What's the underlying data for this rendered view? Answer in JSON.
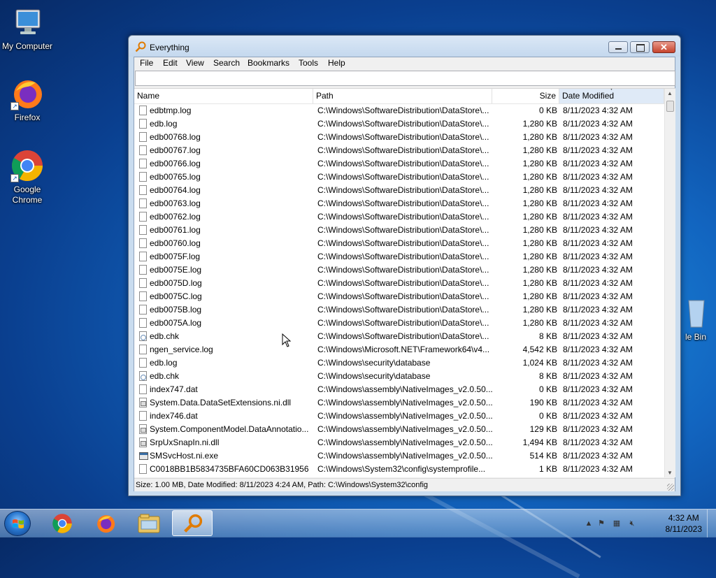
{
  "desktop": {
    "icons": [
      {
        "label": "My Computer"
      },
      {
        "label": "Firefox"
      },
      {
        "label": "Google Chrome"
      },
      {
        "label": "le Bin"
      }
    ]
  },
  "window": {
    "title": "Everything",
    "menu": [
      "File",
      "Edit",
      "View",
      "Search",
      "Bookmarks",
      "Tools",
      "Help"
    ],
    "search": {
      "value": "",
      "placeholder": ""
    },
    "columns": {
      "name": "Name",
      "path": "Path",
      "size": "Size",
      "date": "Date Modified"
    },
    "rows": [
      {
        "name": "edbtmp.log",
        "path": "C:\\Windows\\SoftwareDistribution\\DataStore\\...",
        "size": "0 KB",
        "date": "8/11/2023 4:32 AM",
        "icon": "file-icon"
      },
      {
        "name": "edb.log",
        "path": "C:\\Windows\\SoftwareDistribution\\DataStore\\...",
        "size": "1,280 KB",
        "date": "8/11/2023 4:32 AM",
        "icon": "file-icon"
      },
      {
        "name": "edb00768.log",
        "path": "C:\\Windows\\SoftwareDistribution\\DataStore\\...",
        "size": "1,280 KB",
        "date": "8/11/2023 4:32 AM",
        "icon": "file-icon"
      },
      {
        "name": "edb00767.log",
        "path": "C:\\Windows\\SoftwareDistribution\\DataStore\\...",
        "size": "1,280 KB",
        "date": "8/11/2023 4:32 AM",
        "icon": "file-icon"
      },
      {
        "name": "edb00766.log",
        "path": "C:\\Windows\\SoftwareDistribution\\DataStore\\...",
        "size": "1,280 KB",
        "date": "8/11/2023 4:32 AM",
        "icon": "file-icon"
      },
      {
        "name": "edb00765.log",
        "path": "C:\\Windows\\SoftwareDistribution\\DataStore\\...",
        "size": "1,280 KB",
        "date": "8/11/2023 4:32 AM",
        "icon": "file-icon"
      },
      {
        "name": "edb00764.log",
        "path": "C:\\Windows\\SoftwareDistribution\\DataStore\\...",
        "size": "1,280 KB",
        "date": "8/11/2023 4:32 AM",
        "icon": "file-icon"
      },
      {
        "name": "edb00763.log",
        "path": "C:\\Windows\\SoftwareDistribution\\DataStore\\...",
        "size": "1,280 KB",
        "date": "8/11/2023 4:32 AM",
        "icon": "file-icon"
      },
      {
        "name": "edb00762.log",
        "path": "C:\\Windows\\SoftwareDistribution\\DataStore\\...",
        "size": "1,280 KB",
        "date": "8/11/2023 4:32 AM",
        "icon": "file-icon"
      },
      {
        "name": "edb00761.log",
        "path": "C:\\Windows\\SoftwareDistribution\\DataStore\\...",
        "size": "1,280 KB",
        "date": "8/11/2023 4:32 AM",
        "icon": "file-icon"
      },
      {
        "name": "edb00760.log",
        "path": "C:\\Windows\\SoftwareDistribution\\DataStore\\...",
        "size": "1,280 KB",
        "date": "8/11/2023 4:32 AM",
        "icon": "file-icon"
      },
      {
        "name": "edb0075F.log",
        "path": "C:\\Windows\\SoftwareDistribution\\DataStore\\...",
        "size": "1,280 KB",
        "date": "8/11/2023 4:32 AM",
        "icon": "file-icon"
      },
      {
        "name": "edb0075E.log",
        "path": "C:\\Windows\\SoftwareDistribution\\DataStore\\...",
        "size": "1,280 KB",
        "date": "8/11/2023 4:32 AM",
        "icon": "file-icon"
      },
      {
        "name": "edb0075D.log",
        "path": "C:\\Windows\\SoftwareDistribution\\DataStore\\...",
        "size": "1,280 KB",
        "date": "8/11/2023 4:32 AM",
        "icon": "file-icon"
      },
      {
        "name": "edb0075C.log",
        "path": "C:\\Windows\\SoftwareDistribution\\DataStore\\...",
        "size": "1,280 KB",
        "date": "8/11/2023 4:32 AM",
        "icon": "file-icon"
      },
      {
        "name": "edb0075B.log",
        "path": "C:\\Windows\\SoftwareDistribution\\DataStore\\...",
        "size": "1,280 KB",
        "date": "8/11/2023 4:32 AM",
        "icon": "file-icon"
      },
      {
        "name": "edb0075A.log",
        "path": "C:\\Windows\\SoftwareDistribution\\DataStore\\...",
        "size": "1,280 KB",
        "date": "8/11/2023 4:32 AM",
        "icon": "file-icon"
      },
      {
        "name": "edb.chk",
        "path": "C:\\Windows\\SoftwareDistribution\\DataStore\\...",
        "size": "8 KB",
        "date": "8/11/2023 4:32 AM",
        "icon": "chk-file-icon"
      },
      {
        "name": "ngen_service.log",
        "path": "C:\\Windows\\Microsoft.NET\\Framework64\\v4...",
        "size": "4,542 KB",
        "date": "8/11/2023 4:32 AM",
        "icon": "file-icon"
      },
      {
        "name": "edb.log",
        "path": "C:\\Windows\\security\\database",
        "size": "1,024 KB",
        "date": "8/11/2023 4:32 AM",
        "icon": "file-icon"
      },
      {
        "name": "edb.chk",
        "path": "C:\\Windows\\security\\database",
        "size": "8 KB",
        "date": "8/11/2023 4:32 AM",
        "icon": "chk-file-icon"
      },
      {
        "name": "index747.dat",
        "path": "C:\\Windows\\assembly\\NativeImages_v2.0.50...",
        "size": "0 KB",
        "date": "8/11/2023 4:32 AM",
        "icon": "file-icon"
      },
      {
        "name": "System.Data.DataSetExtensions.ni.dll",
        "path": "C:\\Windows\\assembly\\NativeImages_v2.0.50...",
        "size": "190 KB",
        "date": "8/11/2023 4:32 AM",
        "icon": "dll-file-icon"
      },
      {
        "name": "index746.dat",
        "path": "C:\\Windows\\assembly\\NativeImages_v2.0.50...",
        "size": "0 KB",
        "date": "8/11/2023 4:32 AM",
        "icon": "file-icon"
      },
      {
        "name": "System.ComponentModel.DataAnnotatio...",
        "path": "C:\\Windows\\assembly\\NativeImages_v2.0.50...",
        "size": "129 KB",
        "date": "8/11/2023 4:32 AM",
        "icon": "dll-file-icon"
      },
      {
        "name": "SrpUxSnapIn.ni.dll",
        "path": "C:\\Windows\\assembly\\NativeImages_v2.0.50...",
        "size": "1,494 KB",
        "date": "8/11/2023 4:32 AM",
        "icon": "dll-file-icon"
      },
      {
        "name": "SMSvcHost.ni.exe",
        "path": "C:\\Windows\\assembly\\NativeImages_v2.0.50...",
        "size": "514 KB",
        "date": "8/11/2023 4:32 AM",
        "icon": "exe-file-icon"
      },
      {
        "name": "C0018BB1B5834735BFA60CD063B31956",
        "path": "C:\\Windows\\System32\\config\\systemprofile...",
        "size": "1 KB",
        "date": "8/11/2023 4:32 AM",
        "icon": "file-icon"
      }
    ],
    "status": "Size: 1.00 MB, Date Modified: 8/11/2023 4:24 AM, Path: C:\\Windows\\System32\\config"
  },
  "taskbar": {
    "pinned": [
      "chrome-icon",
      "firefox-icon",
      "file-explorer-icon",
      "everything-search-icon"
    ],
    "active": "everything-search-icon",
    "clock": {
      "time": "4:32 AM",
      "date": "8/11/2023"
    }
  }
}
